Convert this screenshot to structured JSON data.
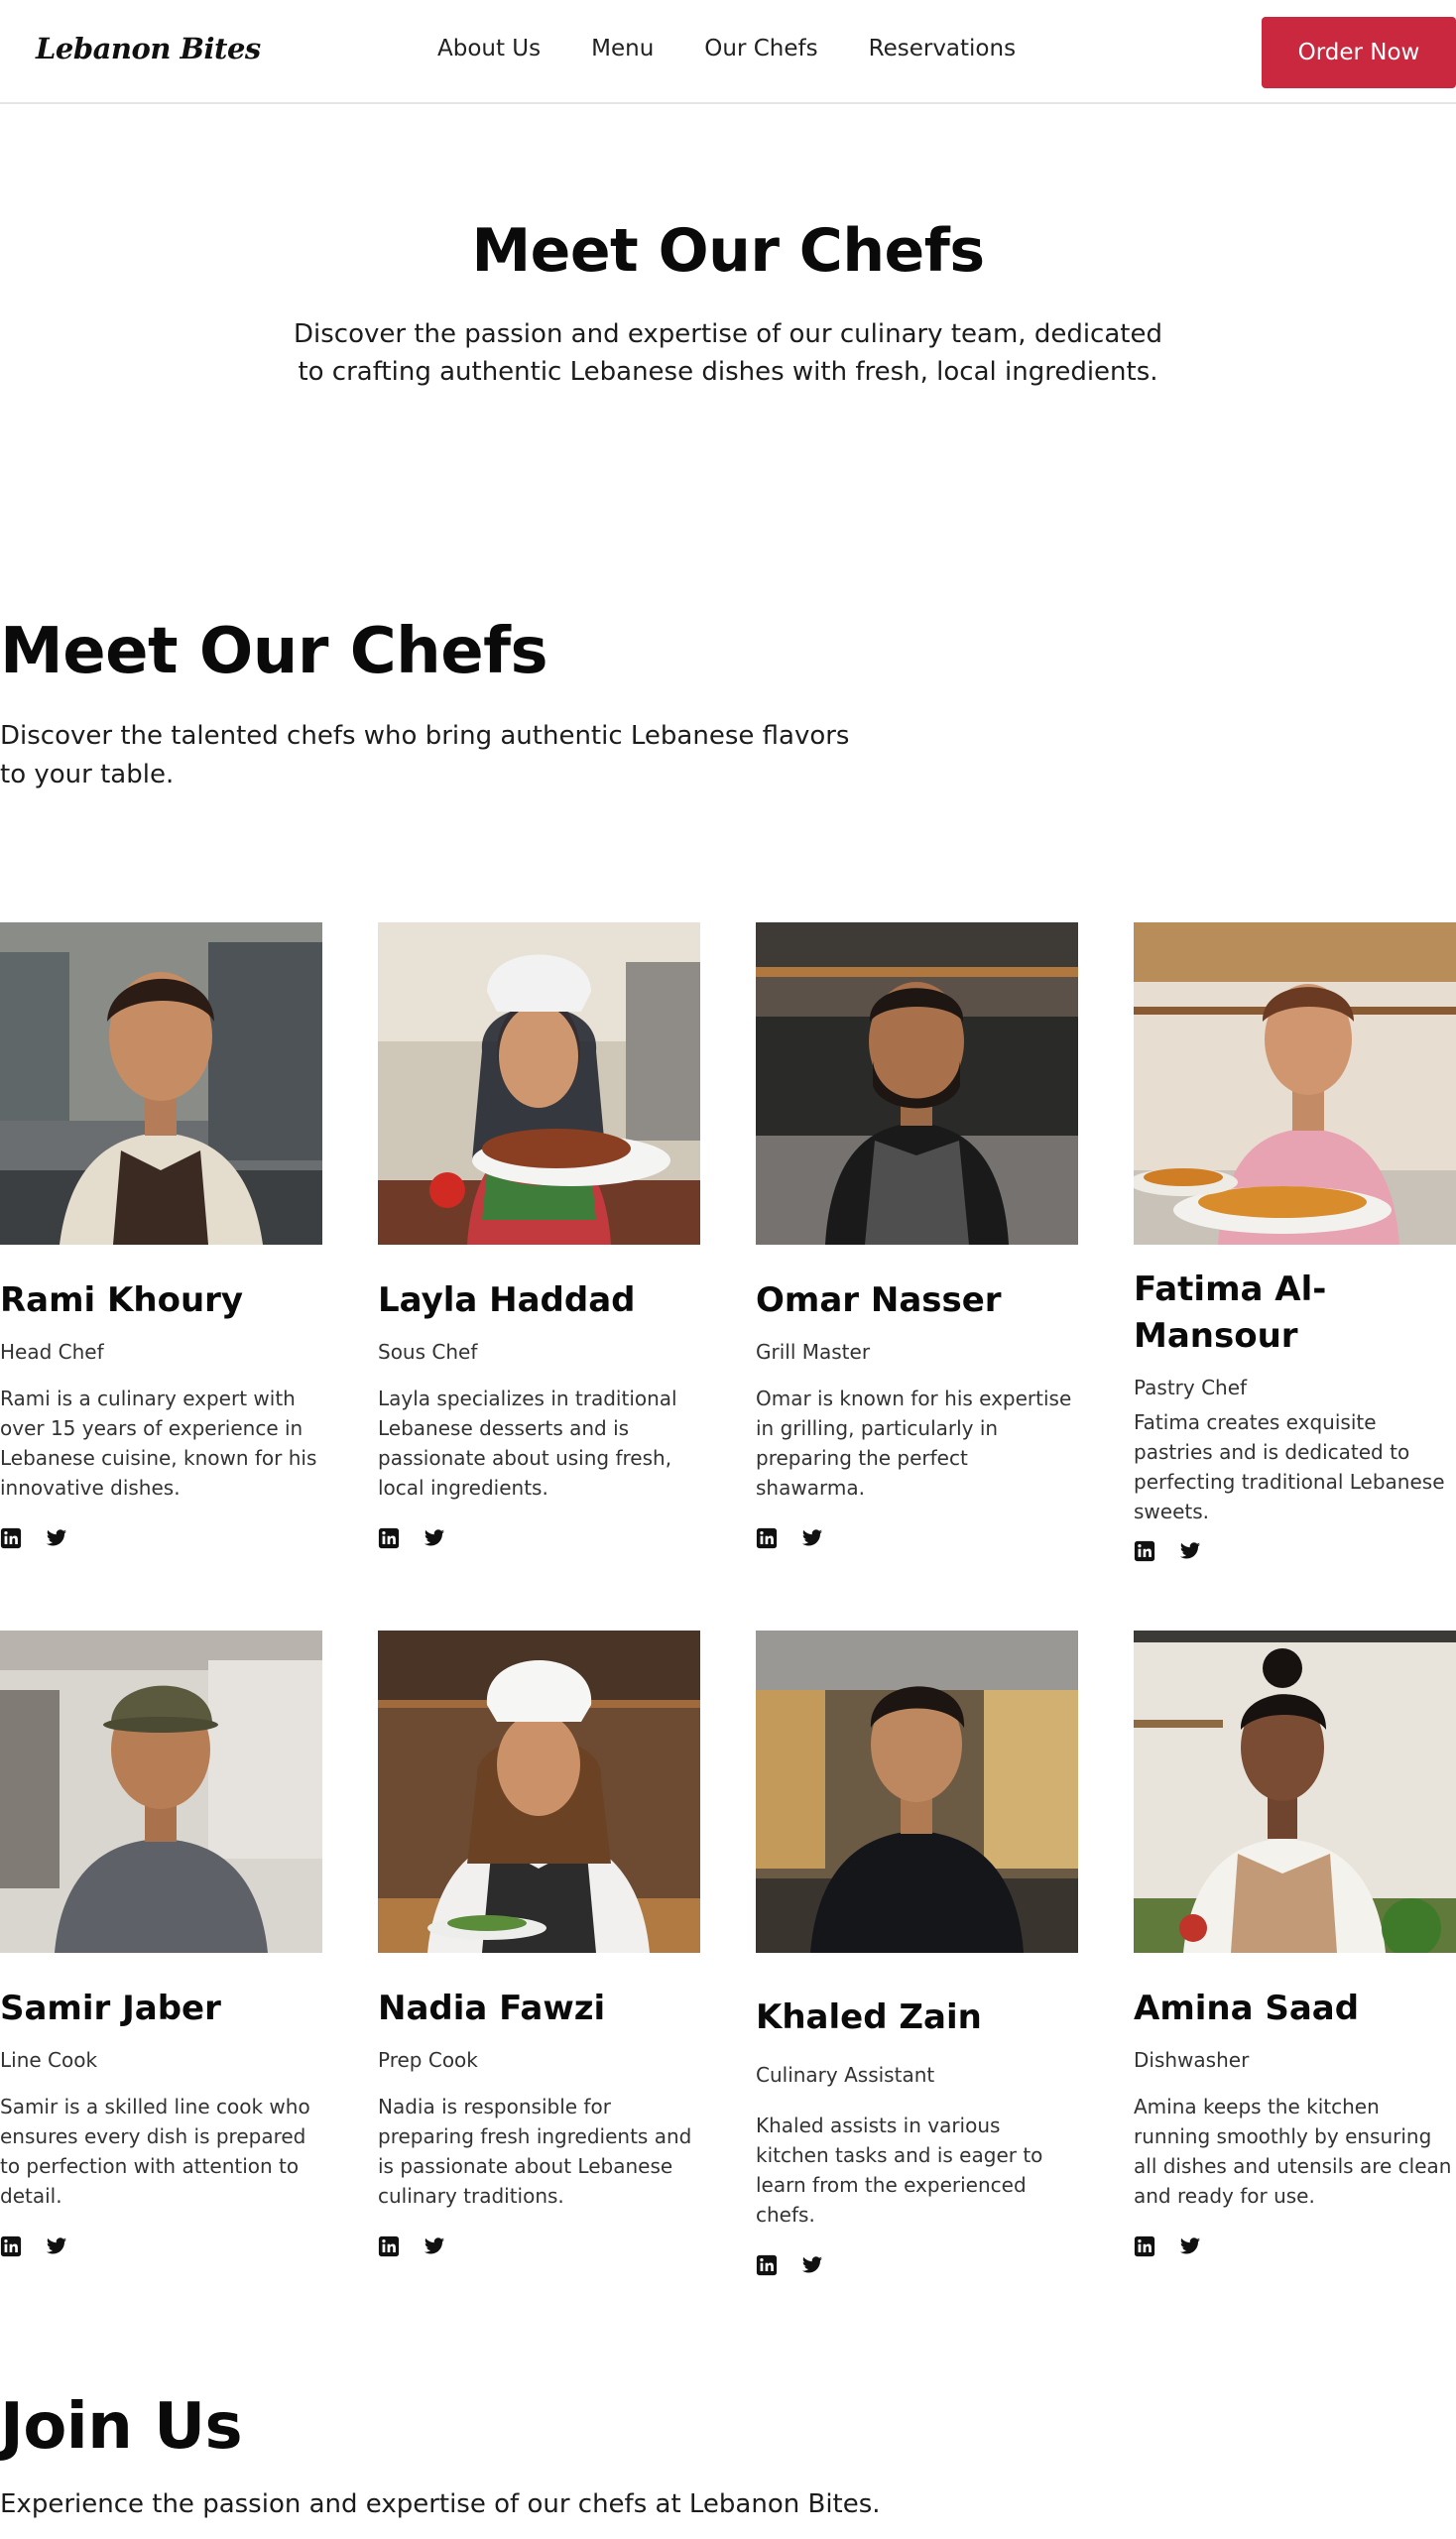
{
  "brand": {
    "logo": "Lebanon Bites",
    "accent": "#c9283f"
  },
  "nav": {
    "items": [
      "About Us",
      "Menu",
      "Our Chefs",
      "Reservations"
    ],
    "cta": "Order Now"
  },
  "hero": {
    "title": "Meet Our Chefs",
    "subtitle": "Discover the passion and expertise of our culinary team, dedicated to crafting authentic Lebanese dishes with fresh, local ingredients."
  },
  "team": {
    "title": "Meet Our Chefs",
    "subtitle": "Discover the talented chefs who bring authentic Lebanese flavors to your table.",
    "chefs": [
      {
        "name": "Rami Khoury",
        "role": "Head Chef",
        "bio": "Rami is a culinary expert with over 15 years of experience in Lebanese cuisine, known for his innovative dishes."
      },
      {
        "name": "Layla Haddad",
        "role": "Sous Chef",
        "bio": "Layla specializes in traditional Lebanese desserts and is passionate about using fresh, local ingredients."
      },
      {
        "name": "Omar Nasser",
        "role": "Grill Master",
        "bio": "Omar is known for his expertise in grilling, particularly in preparing the perfect shawarma."
      },
      {
        "name": "Fatima Al-Mansour",
        "role": "Pastry Chef",
        "bio": "Fatima creates exquisite pastries and is dedicated to perfecting traditional Lebanese sweets."
      },
      {
        "name": "Samir Jaber",
        "role": "Line Cook",
        "bio": "Samir is a skilled line cook who ensures every dish is prepared to perfection with attention to detail."
      },
      {
        "name": "Nadia Fawzi",
        "role": "Prep Cook",
        "bio": "Nadia is responsible for preparing fresh ingredients and is passionate about Lebanese culinary traditions."
      },
      {
        "name": "Khaled Zain",
        "role": "Culinary Assistant",
        "bio": "Khaled assists in various kitchen tasks and is eager to learn from the experienced chefs."
      },
      {
        "name": "Amina Saad",
        "role": "Dishwasher",
        "bio": "Amina keeps the kitchen running smoothly by ensuring all dishes and utensils are clean and ready for use."
      }
    ]
  },
  "social_icons": [
    "linkedin-icon",
    "twitter-icon"
  ],
  "join": {
    "title": "Join Us",
    "subtitle": "Experience the passion and expertise of our chefs at Lebanon Bites."
  }
}
